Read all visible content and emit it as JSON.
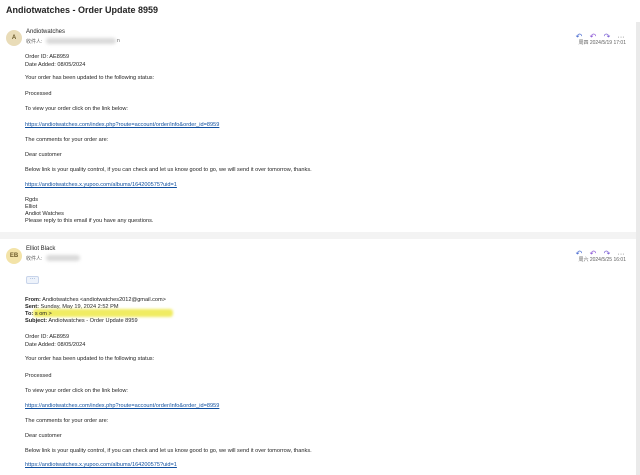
{
  "window": {
    "title": "Andiotwatches - Order Update 8959"
  },
  "messages": [
    {
      "avatar_initials": "A",
      "avatar_bg": "#e9dcb8",
      "avatar_fg": "#6b5a2a",
      "sender": "Andiotwatches",
      "recipient_label": "收件人:",
      "recipient_tail": "n",
      "date": "周四 2024/5/19 17:01",
      "body": {
        "order_id": "Order ID: AE8959",
        "date_added": "Date Added: 08/05/2024",
        "status_intro": "Your order has been updated to the following status:",
        "status": "Processed",
        "view_intro": "To view your order click on the link below:",
        "order_link": "https://andiotwatches.com/index.php?route=account/order/info&order_id=8959",
        "comments_intro": "The comments for your order are:",
        "greeting": "Dear customer",
        "comment": "Below link is your quality control, if you can check and let us know good to go, we will send it over tomorrow, thanks.",
        "album_link": "https://andiotwatches.x.yupoo.com/albums/164200575?uid=1",
        "sig1": "Rgds",
        "sig2": "Elliot",
        "sig3": "Andiot Watches",
        "footer": "Please reply to this email if you have any questions."
      }
    },
    {
      "avatar_initials": "EB",
      "avatar_bg": "#f3e3a8",
      "avatar_fg": "#6b5a2a",
      "sender": "Elliot Black",
      "recipient_label": "收件人:",
      "date": "周六 2024/5/25 16:01",
      "quoted_header": {
        "from_label": "From:",
        "from_value": "Andiotwatches <andiotwatches2012@gmail.com>",
        "sent_label": "Sent:",
        "sent_value": "Sunday, May 19, 2024 2:52 PM",
        "to_label": "To:",
        "to_value": "s                                   om >",
        "subject_label": "Subject:",
        "subject_value": "Andiotwatches - Order Update 8959"
      },
      "body": {
        "order_id": "Order ID: AE8959",
        "date_added": "Date Added: 08/05/2024",
        "status_intro": "Your order has been updated to the following status:",
        "status": "Processed",
        "view_intro": "To view your order click on the link below:",
        "order_link": "https://andiotwatches.com/index.php?route=account/order/info&order_id=8959",
        "comments_intro": "The comments for your order are:",
        "greeting": "Dear customer",
        "comment": "Below link is your quality control, if you can check and let us know good to go, we will send it over tomorrow, thanks.",
        "album_link": "https://andiotwatches.x.yupoo.com/albums/164200575?uid=1"
      }
    }
  ],
  "actions": {
    "reply_icon": "reply-icon",
    "reply_all_icon": "reply-all-icon",
    "forward_icon": "forward-icon",
    "more_icon": "more-icon",
    "more_glyph": "···"
  },
  "show_quoted_glyph": "···"
}
